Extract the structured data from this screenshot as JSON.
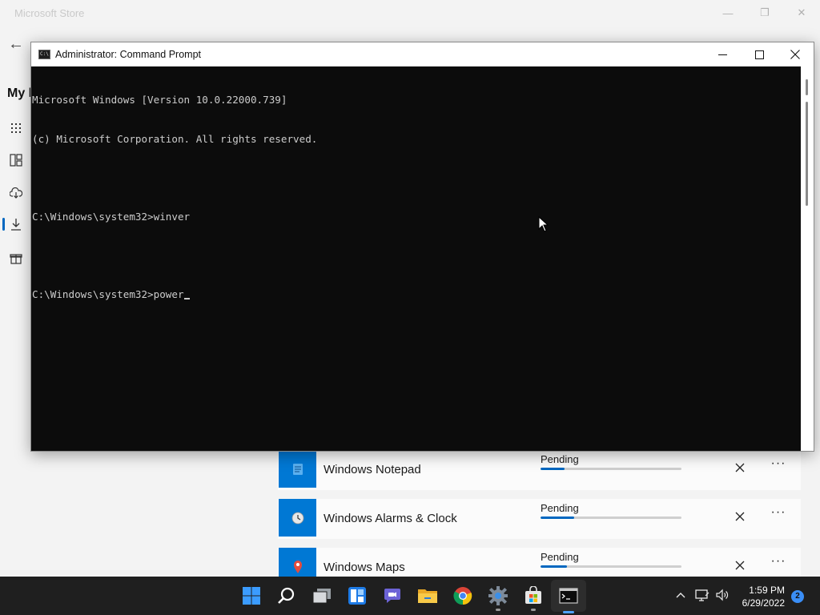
{
  "store": {
    "title": "Microsoft Store",
    "heading": "My l",
    "downloads": [
      {
        "name": "Windows Notepad",
        "status": "Pending",
        "progress": 0.17
      },
      {
        "name": "Windows Alarms & Clock",
        "status": "Pending",
        "progress": 0.24
      },
      {
        "name": "Windows Maps",
        "status": "Pending",
        "progress": 0.19
      }
    ]
  },
  "cmd": {
    "title": "Administrator: Command Prompt",
    "lines": [
      "Microsoft Windows [Version 10.0.22000.739]",
      "(c) Microsoft Corporation. All rights reserved.",
      "",
      "C:\\Windows\\system32>winver",
      "",
      "C:\\Windows\\system32>power"
    ]
  },
  "taskbar": {
    "time": "1:59 PM",
    "date": "6/29/2022",
    "notifications": "2",
    "apps": [
      "start-icon",
      "search-icon",
      "task-view-icon",
      "widgets-icon",
      "teams-chat-icon",
      "file-explorer-icon",
      "chrome-icon",
      "settings-icon",
      "store-icon",
      "command-prompt-icon"
    ]
  },
  "colors": {
    "accent": "#0078d4",
    "console_bg": "#0c0c0c",
    "console_text": "#cccccc",
    "taskbar_bg": "#1f1f1f"
  }
}
